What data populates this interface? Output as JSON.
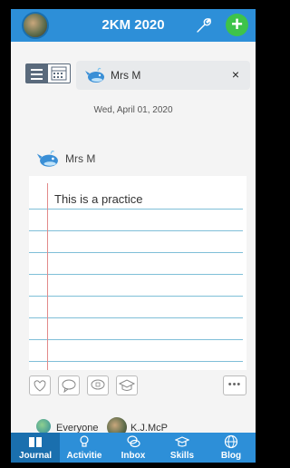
{
  "header": {
    "title": "2KM 2020",
    "add_symbol": "+"
  },
  "filter_chip": {
    "name": "Mrs M",
    "close_symbol": "×"
  },
  "entry": {
    "date": "Wed, April 01, 2020",
    "author": "Mrs M",
    "text": "This is a practice",
    "more_symbol": "•••"
  },
  "share": {
    "everyone": "Everyone",
    "person": "K.J.McP"
  },
  "tabs": [
    {
      "label": "Journal",
      "icon": "journal-icon",
      "active": true
    },
    {
      "label": "Activitie",
      "icon": "lightbulb-icon",
      "active": false
    },
    {
      "label": "Inbox",
      "icon": "chat-bubbles-icon",
      "active": false
    },
    {
      "label": "Skills",
      "icon": "graduation-cap-icon",
      "active": false
    },
    {
      "label": "Blog",
      "icon": "globe-icon",
      "active": false
    }
  ],
  "colors": {
    "brand_blue": "#2d8fd8",
    "active_tab": "#1a6fae",
    "add_green": "#3ec34a"
  }
}
